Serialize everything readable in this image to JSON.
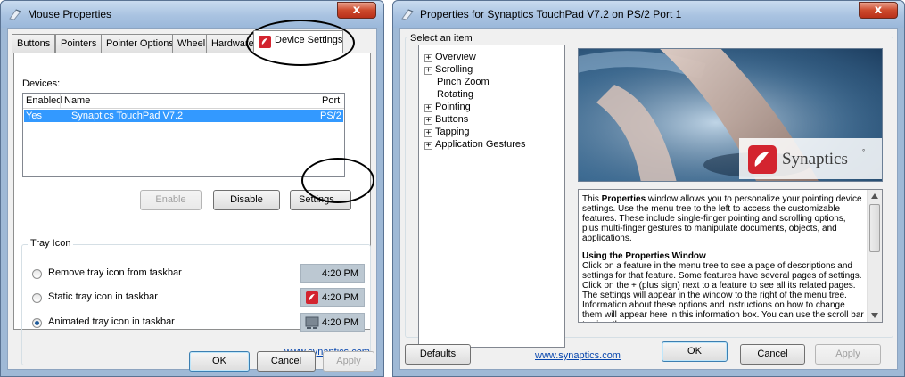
{
  "mouse_window": {
    "title": "Mouse Properties",
    "close_glyph": "x",
    "tabs": [
      "Buttons",
      "Pointers",
      "Pointer Options",
      "Wheel",
      "Hardware",
      "Device Settings"
    ],
    "devices_label": "Devices:",
    "columns": {
      "enabled": "Enabled",
      "name": "Name",
      "port": "Port"
    },
    "device_row": {
      "enabled": "Yes",
      "name": "Synaptics TouchPad V7.2",
      "port": "PS/2"
    },
    "enable_button": "Enable",
    "disable_button": "Disable",
    "settings_button": "Settings...",
    "tray_group_label": "Tray Icon",
    "tray_options": [
      {
        "label": "Remove tray icon from taskbar",
        "time": "4:20 PM",
        "checked": false
      },
      {
        "label": "Static tray icon in taskbar",
        "time": "4:20 PM",
        "checked": false
      },
      {
        "label": "Animated tray icon in taskbar",
        "time": "4:20 PM",
        "checked": true
      }
    ],
    "link": "www.synaptics.com",
    "ok_button": "OK",
    "cancel_button": "Cancel",
    "apply_button": "Apply"
  },
  "synaptics_window": {
    "title": "Properties for Synaptics TouchPad V7.2 on PS/2 Port 1",
    "close_glyph": "x",
    "select_label": "Select an item",
    "tree": [
      {
        "label": "Overview",
        "expandable": true
      },
      {
        "label": "Scrolling",
        "expandable": true
      },
      {
        "label": "Pinch Zoom",
        "expandable": false
      },
      {
        "label": "Rotating",
        "expandable": false
      },
      {
        "label": "Pointing",
        "expandable": true
      },
      {
        "label": "Buttons",
        "expandable": true
      },
      {
        "label": "Tapping",
        "expandable": true
      },
      {
        "label": "Application Gestures",
        "expandable": true
      }
    ],
    "expander_glyph": "+",
    "brand_name": "Synaptics",
    "brand_mark": "°",
    "info": {
      "p1_pre": "This ",
      "p1_bold": "Properties",
      "p1_post": " window allows you to personalize your pointing device settings.  Use the menu tree to the left to access the customizable features.  These include single-finger pointing and scrolling options, plus multi-finger gestures to manipulate documents, objects, and applications.",
      "heading": "Using the Properties Window",
      "p2": "Click on a feature in the menu tree to see a page of descriptions and settings for that feature.  Some features have several pages of settings.  Click on the + (plus sign) next to a feature to see all its related pages.  The settings will appear in the window to the right of the menu tree.  Information about these options and instructions on how to change them will appear here in this information box.  You can use the scroll bar to view the"
    },
    "defaults_button": "Defaults",
    "link": "www.synaptics.com",
    "ok_button": "OK",
    "cancel_button": "Cancel",
    "apply_button": "Apply"
  },
  "colors": {
    "selection": "#3399ff",
    "synaptics_red": "#d3242f",
    "title_close": "#cd4a2c"
  }
}
